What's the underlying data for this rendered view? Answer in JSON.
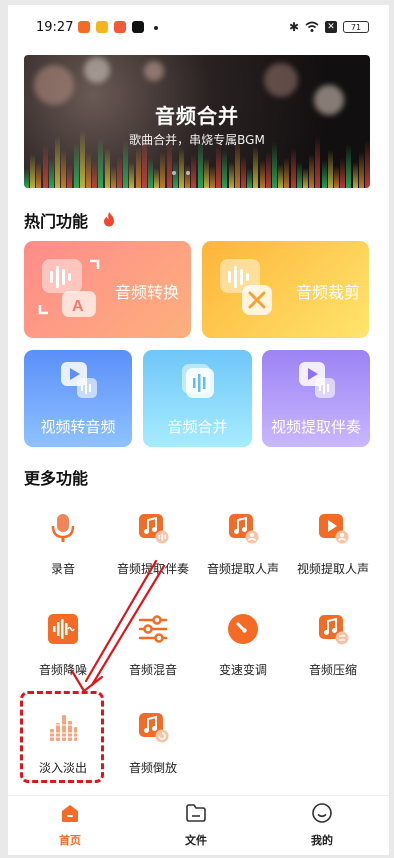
{
  "status_bar": {
    "time": "19:27",
    "battery": "71"
  },
  "banner": {
    "title": "音频合并",
    "subtitle": "歌曲合并，串烧专属BGM"
  },
  "hot": {
    "title": "热门功能",
    "big_cards": [
      {
        "label": "音频转换",
        "color_from": "#ff8b8b",
        "color_to": "#fdb07c"
      },
      {
        "label": "音频裁剪",
        "color_from": "#ffba3c",
        "color_to": "#ffe16b"
      }
    ],
    "small_cards": [
      {
        "label": "视频转音频",
        "color_from": "#5b8ff9",
        "color_to": "#8ec2ff"
      },
      {
        "label": "音频合并",
        "color_from": "#6fc6f8",
        "color_to": "#a6ecff"
      },
      {
        "label": "视频提取伴奏",
        "color_from": "#9b83f4",
        "color_to": "#c9b7ff"
      }
    ]
  },
  "more": {
    "title": "更多功能",
    "items": [
      {
        "label": "录音",
        "icon": "microphone-icon"
      },
      {
        "label": "音频提取伴奏",
        "icon": "music-note-icon"
      },
      {
        "label": "音频提取人声",
        "icon": "music-person-icon"
      },
      {
        "label": "视频提取人声",
        "icon": "video-play-icon"
      },
      {
        "label": "音频降噪",
        "icon": "waveform-icon"
      },
      {
        "label": "音频混音",
        "icon": "sliders-icon"
      },
      {
        "label": "变速变调",
        "icon": "speed-gauge-icon"
      },
      {
        "label": "音频压缩",
        "icon": "compress-icon"
      },
      {
        "label": "淡入淡出",
        "icon": "equalizer-icon"
      },
      {
        "label": "音频倒放",
        "icon": "reverse-icon"
      }
    ]
  },
  "nav": {
    "items": [
      {
        "label": "首页",
        "active": true
      },
      {
        "label": "文件",
        "active": false
      },
      {
        "label": "我的",
        "active": false
      }
    ]
  },
  "accent": "#f36b25"
}
